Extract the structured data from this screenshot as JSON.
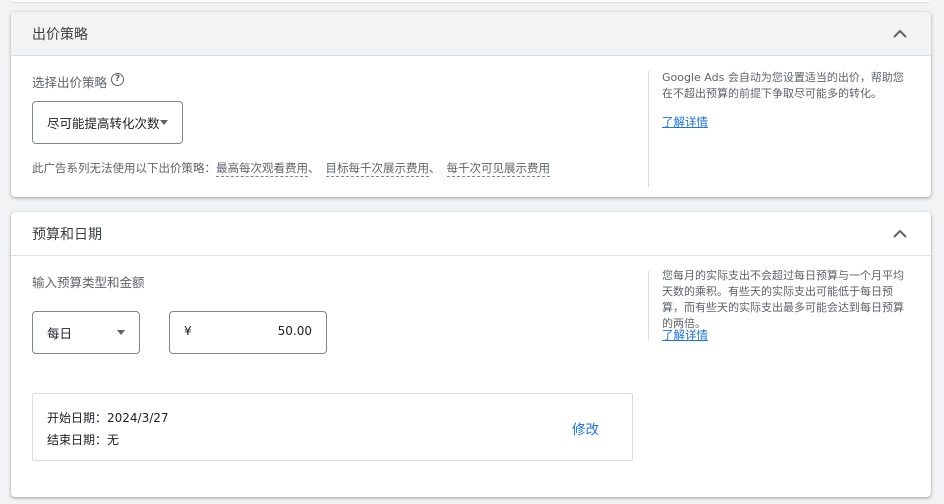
{
  "bidding": {
    "title": "出价策略",
    "choose_label": "选择出价策略",
    "strategy_value": "尽可能提高转化次数",
    "unavailable_prefix": "此广告系列无法使用以下出价策略：",
    "unavailable_items": [
      "最高每次观看费用",
      "目标每千次展示费用",
      "每千次可见展示费用"
    ],
    "side_text": "Google Ads 会自动为您设置适当的出价，帮助您在不超出预算的前提下争取尽可能多的转化。",
    "learn_more": "了解详情"
  },
  "budget": {
    "title": "预算和日期",
    "input_label": "输入预算类型和金额",
    "budget_type": "每日",
    "currency_symbol": "¥",
    "amount": "50.00",
    "side_text": "您每月的实际支出不会超过每日预算与一个月平均天数的乘积。有些天的实际支出可能低于每日预算，而有些天的实际支出最多可能会达到每日预算的两倍。",
    "learn_more": "了解详情",
    "start_date_label": "开始日期：",
    "start_date": "2024/3/27",
    "end_date_label": "结束日期：",
    "end_date": "无",
    "edit": "修改"
  },
  "icons": {
    "collapse": "chevron-up-icon",
    "help": "help-circle-icon",
    "dropdown": "caret-down-icon"
  },
  "colors": {
    "accent": "#1a73e8",
    "text": "#3c4043",
    "muted": "#5f6368",
    "background": "#f1f3f4"
  }
}
